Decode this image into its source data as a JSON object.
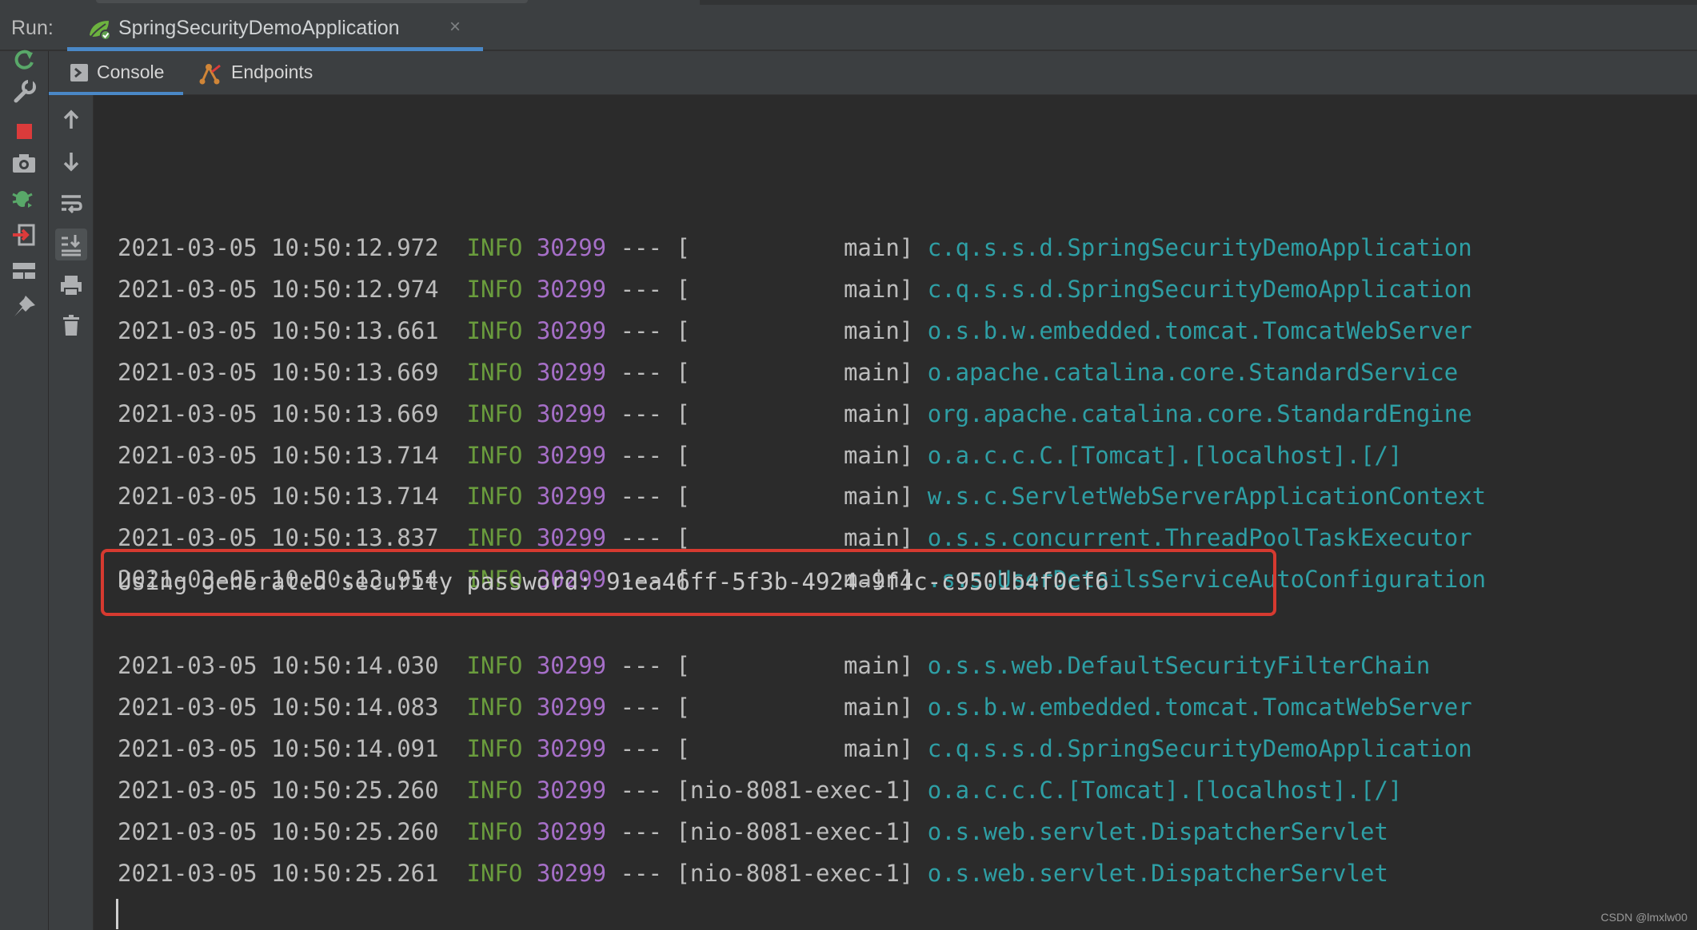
{
  "run_bar": {
    "label": "Run:",
    "tab_title": "SpringSecurityDemoApplication",
    "tab_close": "×"
  },
  "subtabs": [
    {
      "label": "Console",
      "icon": "console-icon",
      "active": true
    },
    {
      "label": "Endpoints",
      "icon": "endpoints-icon",
      "active": false
    }
  ],
  "left_toolbar": [
    "rerun-icon",
    "wrench-icon",
    "stop-icon",
    "camera-icon",
    "debug-icon",
    "exit-icon",
    "layout-icon",
    "pin-icon"
  ],
  "console_toolbar": [
    "arrow-up-icon",
    "arrow-down-icon",
    "soft-wrap-icon",
    "scroll-to-end-icon",
    "print-icon",
    "trash-icon"
  ],
  "log_lines_before": [
    {
      "timestamp": "2021-03-05 10:50:12.972",
      "level": "INFO",
      "pid": "30299",
      "sep": "---",
      "thread": "[           main]",
      "logger": "c.q.s.s.d.SpringSecurityDemoApplication"
    },
    {
      "timestamp": "2021-03-05 10:50:12.974",
      "level": "INFO",
      "pid": "30299",
      "sep": "---",
      "thread": "[           main]",
      "logger": "c.q.s.s.d.SpringSecurityDemoApplication"
    },
    {
      "timestamp": "2021-03-05 10:50:13.661",
      "level": "INFO",
      "pid": "30299",
      "sep": "---",
      "thread": "[           main]",
      "logger": "o.s.b.w.embedded.tomcat.TomcatWebServer"
    },
    {
      "timestamp": "2021-03-05 10:50:13.669",
      "level": "INFO",
      "pid": "30299",
      "sep": "---",
      "thread": "[           main]",
      "logger": "o.apache.catalina.core.StandardService"
    },
    {
      "timestamp": "2021-03-05 10:50:13.669",
      "level": "INFO",
      "pid": "30299",
      "sep": "---",
      "thread": "[           main]",
      "logger": "org.apache.catalina.core.StandardEngine"
    },
    {
      "timestamp": "2021-03-05 10:50:13.714",
      "level": "INFO",
      "pid": "30299",
      "sep": "---",
      "thread": "[           main]",
      "logger": "o.a.c.c.C.[Tomcat].[localhost].[/]"
    },
    {
      "timestamp": "2021-03-05 10:50:13.714",
      "level": "INFO",
      "pid": "30299",
      "sep": "---",
      "thread": "[           main]",
      "logger": "w.s.c.ServletWebServerApplicationContext"
    },
    {
      "timestamp": "2021-03-05 10:50:13.837",
      "level": "INFO",
      "pid": "30299",
      "sep": "---",
      "thread": "[           main]",
      "logger": "o.s.s.concurrent.ThreadPoolTaskExecutor"
    },
    {
      "timestamp": "2021-03-05 10:50:13.954",
      "level": "INFO",
      "pid": "30299",
      "sep": "---",
      "thread": "[           main]",
      "logger": ".s.s.UserDetailsServiceAutoConfiguration"
    }
  ],
  "password_line": "Using generated security password: 91ea46ff-5f3b-4924-9f4c-c9501b4f0cf6",
  "log_lines_after": [
    {
      "timestamp": "2021-03-05 10:50:14.030",
      "level": "INFO",
      "pid": "30299",
      "sep": "---",
      "thread": "[           main]",
      "logger": "o.s.s.web.DefaultSecurityFilterChain"
    },
    {
      "timestamp": "2021-03-05 10:50:14.083",
      "level": "INFO",
      "pid": "30299",
      "sep": "---",
      "thread": "[           main]",
      "logger": "o.s.b.w.embedded.tomcat.TomcatWebServer"
    },
    {
      "timestamp": "2021-03-05 10:50:14.091",
      "level": "INFO",
      "pid": "30299",
      "sep": "---",
      "thread": "[           main]",
      "logger": "c.q.s.s.d.SpringSecurityDemoApplication"
    },
    {
      "timestamp": "2021-03-05 10:50:25.260",
      "level": "INFO",
      "pid": "30299",
      "sep": "---",
      "thread": "[nio-8081-exec-1]",
      "logger": "o.a.c.c.C.[Tomcat].[localhost].[/]"
    },
    {
      "timestamp": "2021-03-05 10:50:25.260",
      "level": "INFO",
      "pid": "30299",
      "sep": "---",
      "thread": "[nio-8081-exec-1]",
      "logger": "o.s.web.servlet.DispatcherServlet"
    },
    {
      "timestamp": "2021-03-05 10:50:25.261",
      "level": "INFO",
      "pid": "30299",
      "sep": "---",
      "thread": "[nio-8081-exec-1]",
      "logger": "o.s.web.servlet.DispatcherServlet"
    }
  ],
  "watermark": "CSDN @lmxlw00",
  "colors": {
    "level": "#6a9c3d",
    "pid": "#a66fc8",
    "logger": "#2e9fa5",
    "highlight_box": "#d63a30",
    "tab_underline": "#4a88c7"
  }
}
